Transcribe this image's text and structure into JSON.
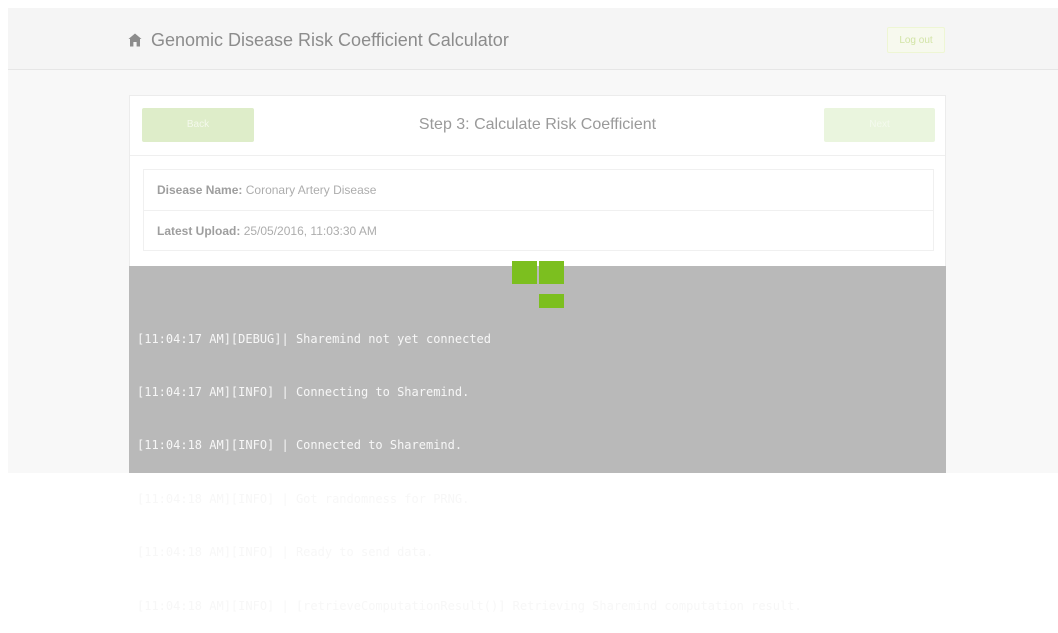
{
  "header": {
    "title": "Genomic Disease Risk Coefficient Calculator",
    "home_icon": "home-icon",
    "logout_label": "Log out"
  },
  "panel": {
    "step_title": "Step 3: Calculate Risk Coefficient",
    "back_label": "Back",
    "next_label": "Next"
  },
  "info": {
    "disease_label": "Disease Name:",
    "disease_value": "Coronary Artery Disease",
    "upload_label": "Latest Upload:",
    "upload_value": "25/05/2016, 11:03:30 AM"
  },
  "log": [
    "[11:04:17 AM][DEBUG]| Sharemind not yet connected",
    "[11:04:17 AM][INFO] | Connecting to Sharemind.",
    "[11:04:18 AM][INFO] | Connected to Sharemind.",
    "[11:04:18 AM][INFO] | Got randomness for PRNG.",
    "[11:04:18 AM][INFO] | Ready to send data.",
    "[11:04:18 AM][INFO] | [retrieveComputationResult()] Retrieving Sharemind computation result."
  ],
  "colors": {
    "accent": "#7cbf1f",
    "overlay": "#b9b9b9",
    "button": "#deedc9"
  }
}
